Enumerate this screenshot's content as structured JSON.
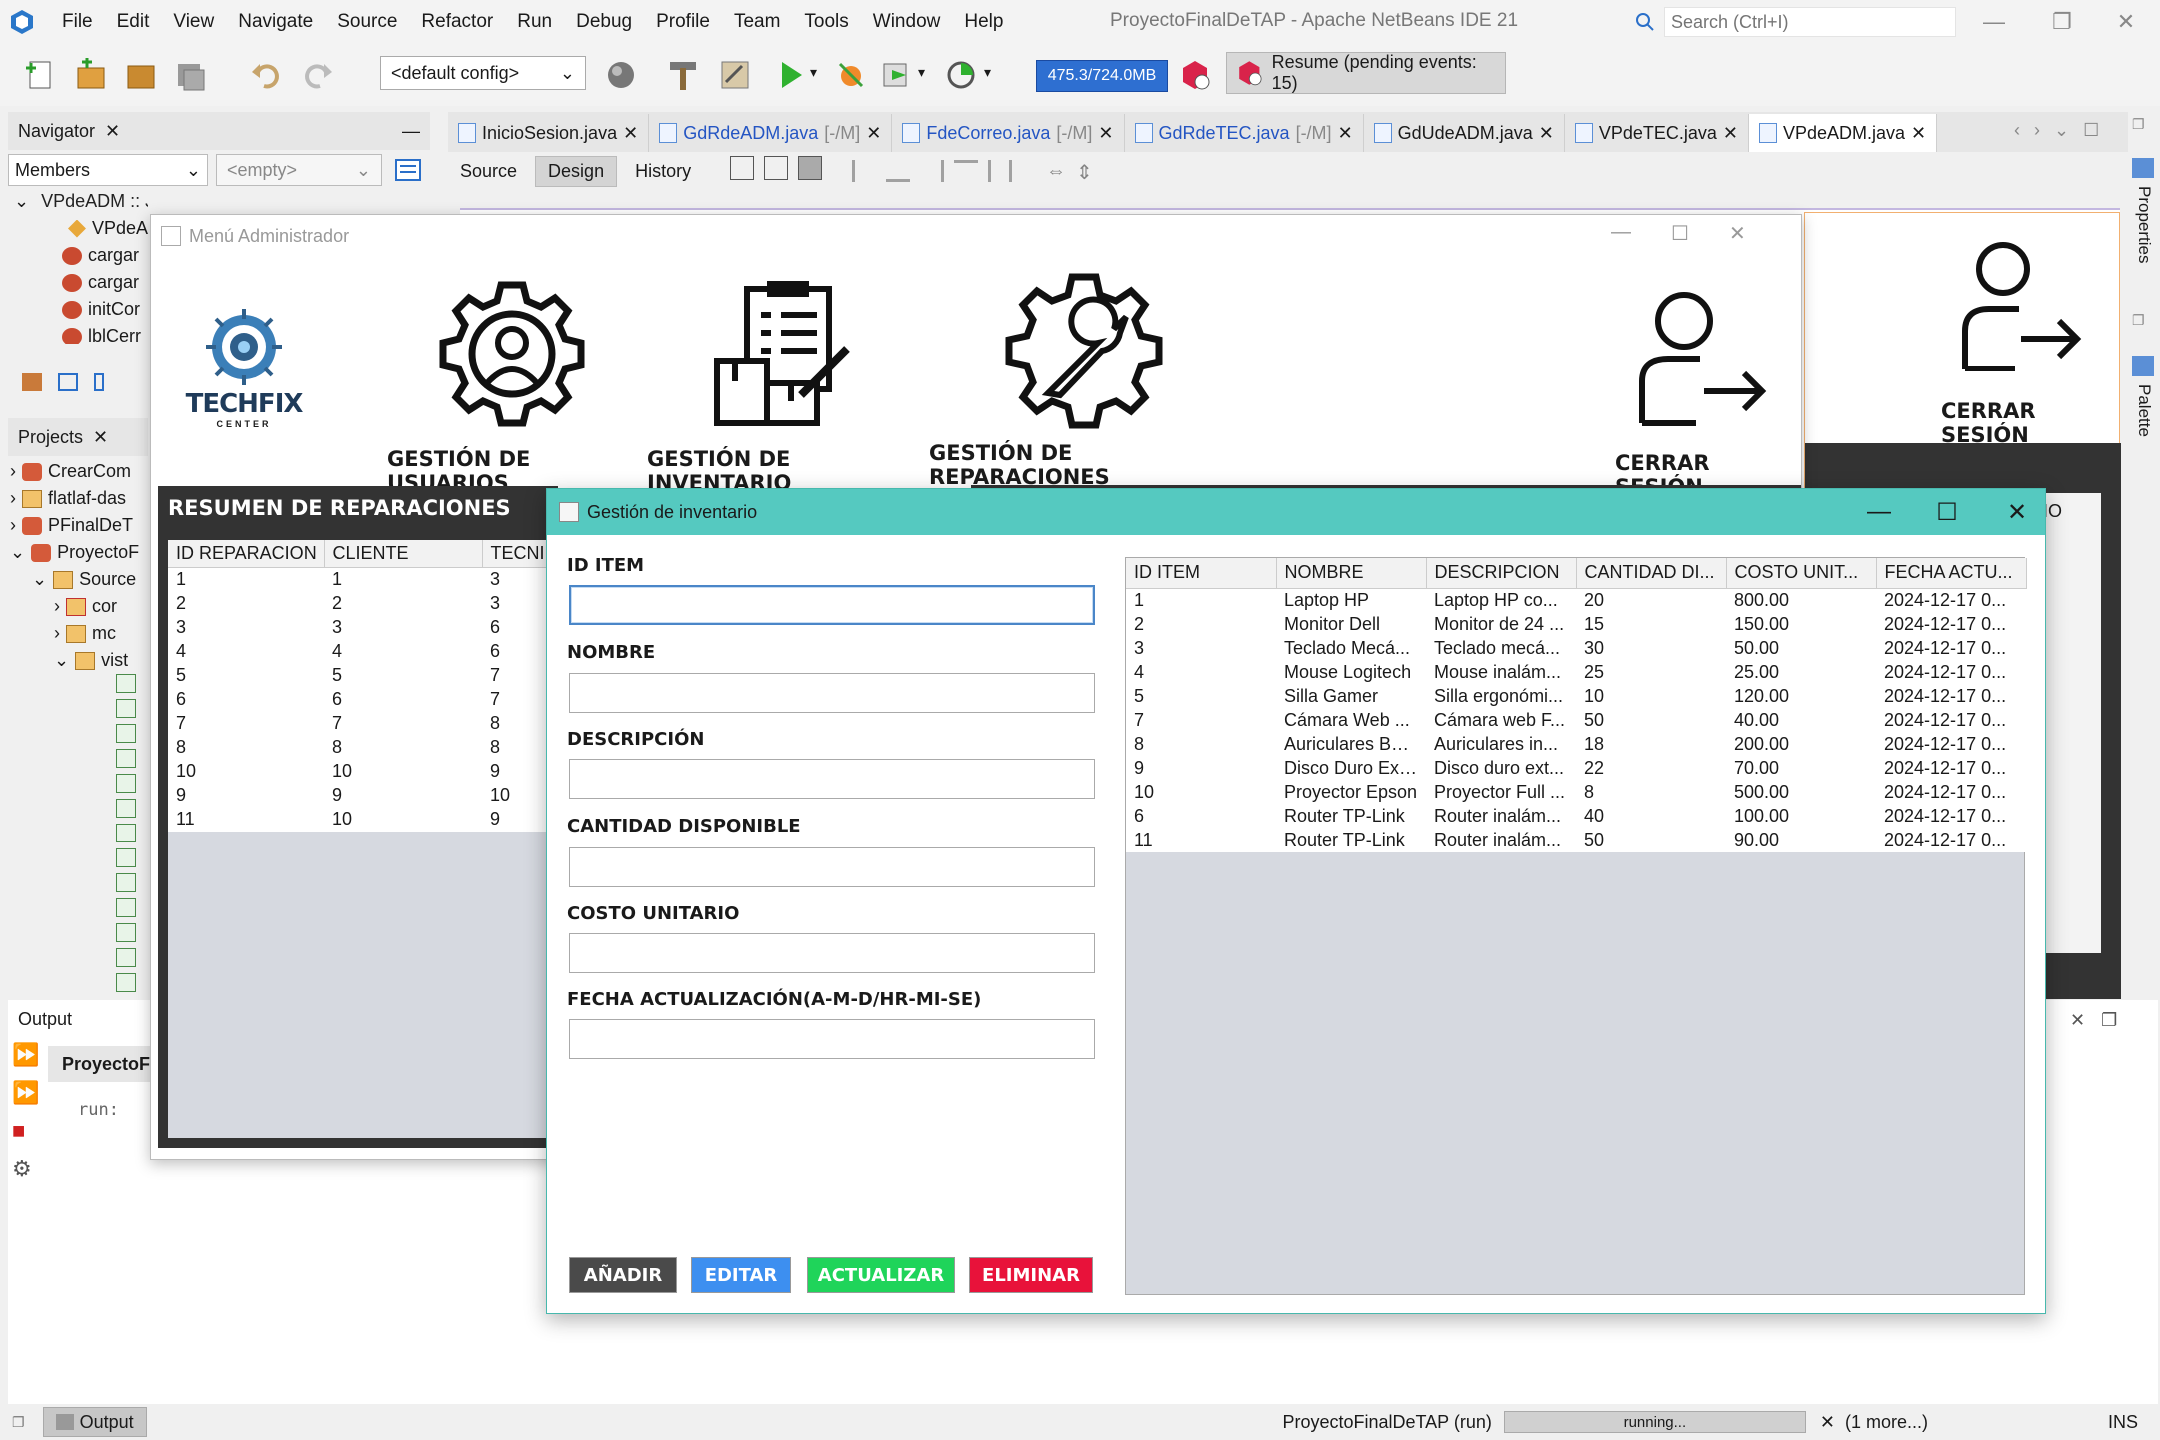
{
  "ide": {
    "title": "ProyectoFinalDeTAP - Apache NetBeans IDE 21",
    "menu": [
      "File",
      "Edit",
      "View",
      "Navigate",
      "Source",
      "Refactor",
      "Run",
      "Debug",
      "Profile",
      "Team",
      "Tools",
      "Window",
      "Help"
    ],
    "search_placeholder": "Search (Ctrl+I)",
    "config": "<default config>",
    "memory": "475.3/724.0MB",
    "resume": "Resume (pending events: 15)"
  },
  "navigator": {
    "title": "Navigator",
    "filter": "Members",
    "filter2": "<empty>",
    "items": [
      "VPdeADM :: JFrame",
      "VPdeA",
      "cargar",
      "cargar",
      "initCor",
      "lblCerr"
    ]
  },
  "projects": {
    "title": "Projects",
    "items": [
      "CrearCom",
      "flatlaf-das",
      "PFinalDeT",
      "ProyectoF",
      "Source",
      "cor",
      "mc",
      "vist"
    ]
  },
  "editor": {
    "tabs": [
      {
        "name": "InicioSesion.java",
        "suffix": "",
        "modified": false
      },
      {
        "name": "GdRdeADM.java",
        "suffix": "[-/M]",
        "modified": true
      },
      {
        "name": "FdeCorreo.java",
        "suffix": "[-/M]",
        "modified": true
      },
      {
        "name": "GdRdeTEC.java",
        "suffix": "[-/M]",
        "modified": true
      },
      {
        "name": "GdUdeADM.java",
        "suffix": "",
        "modified": false
      },
      {
        "name": "VPdeTEC.java",
        "suffix": "",
        "modified": false
      },
      {
        "name": "VPdeADM.java",
        "suffix": "",
        "modified": false
      }
    ],
    "subtabs": [
      "Source",
      "Design",
      "History"
    ]
  },
  "menu_admin": {
    "title": "Menú Administrador",
    "logo_text": "TECHFIX",
    "logo_sub": "CENTER",
    "buttons": [
      "GESTIÓN DE USUARIOS",
      "GESTIÓN DE INVENTARIO",
      "GESTIÓN DE REPARACIONES",
      "CERRAR SESIÓN"
    ],
    "bg_logout": "CERRAR SESIÓN",
    "bg_col": "IO"
  },
  "summary": {
    "title": "RESUMEN DE REPARACIONES",
    "columns": [
      "ID REPARACION",
      "CLIENTE",
      "TECNI"
    ],
    "rows": [
      [
        "1",
        "1",
        "3"
      ],
      [
        "2",
        "2",
        "3"
      ],
      [
        "3",
        "3",
        "6"
      ],
      [
        "4",
        "4",
        "6"
      ],
      [
        "5",
        "5",
        "7"
      ],
      [
        "6",
        "6",
        "7"
      ],
      [
        "7",
        "7",
        "8"
      ],
      [
        "8",
        "8",
        "8"
      ],
      [
        "10",
        "10",
        "9"
      ],
      [
        "9",
        "9",
        "10"
      ],
      [
        "11",
        "10",
        "9"
      ]
    ]
  },
  "inventory": {
    "title": "Gestión de inventario",
    "labels": {
      "id": "ID ITEM",
      "name": "NOMBRE",
      "desc": "DESCRIPCIÓN",
      "qty": "CANTIDAD DISPONIBLE",
      "cost": "COSTO UNITARIO",
      "date": "FECHA ACTUALIZACIÓN(A-M-D/HR-MI-SE)"
    },
    "buttons": {
      "add": "AÑADIR",
      "edit": "EDITAR",
      "update": "ACTUALIZAR",
      "delete": "ELIMINAR"
    },
    "colors": {
      "add": "#4a4a4a",
      "edit": "#3d8ff0",
      "update": "#1fd45a",
      "delete": "#e8123a",
      "titlebar": "#55c9c0"
    },
    "columns": [
      "ID ITEM",
      "NOMBRE",
      "DESCRIPCION",
      "CANTIDAD DI...",
      "COSTO UNIT...",
      "FECHA ACTU..."
    ],
    "rows": [
      [
        "1",
        "Laptop HP",
        "Laptop HP co...",
        "20",
        "800.00",
        "2024-12-17 0..."
      ],
      [
        "2",
        "Monitor Dell",
        "Monitor de 24 ...",
        "15",
        "150.00",
        "2024-12-17 0..."
      ],
      [
        "3",
        "Teclado Mecá...",
        "Teclado mecá...",
        "30",
        "50.00",
        "2024-12-17 0..."
      ],
      [
        "4",
        "Mouse Logitech",
        "Mouse inalám...",
        "25",
        "25.00",
        "2024-12-17 0..."
      ],
      [
        "5",
        "Silla Gamer",
        "Silla ergonómi...",
        "10",
        "120.00",
        "2024-12-17 0..."
      ],
      [
        "7",
        "Cámara Web ...",
        "Cámara web F...",
        "50",
        "40.00",
        "2024-12-17 0..."
      ],
      [
        "8",
        "Auriculares Bose",
        "Auriculares in...",
        "18",
        "200.00",
        "2024-12-17 0..."
      ],
      [
        "9",
        "Disco Duro Ext...",
        "Disco duro ext...",
        "22",
        "70.00",
        "2024-12-17 0..."
      ],
      [
        "10",
        "Proyector Epson",
        "Proyector Full ...",
        "8",
        "500.00",
        "2024-12-17 0..."
      ],
      [
        "6",
        "Router TP-Link",
        "Router inalám...",
        "40",
        "100.00",
        "2024-12-17 0..."
      ],
      [
        "11",
        "Router TP-Link",
        "Router inalám...",
        "50",
        "90.00",
        "2024-12-17 0..."
      ]
    ]
  },
  "output": {
    "title": "Output",
    "tab": "ProyectoF",
    "text": "run:"
  },
  "status": {
    "tab": "Output",
    "project": "ProyectoFinalDeTAP (run)",
    "progress": "running...",
    "more": "(1 more...)",
    "mode": "INS"
  },
  "side": {
    "properties": "Properties",
    "palette": "Palette"
  }
}
